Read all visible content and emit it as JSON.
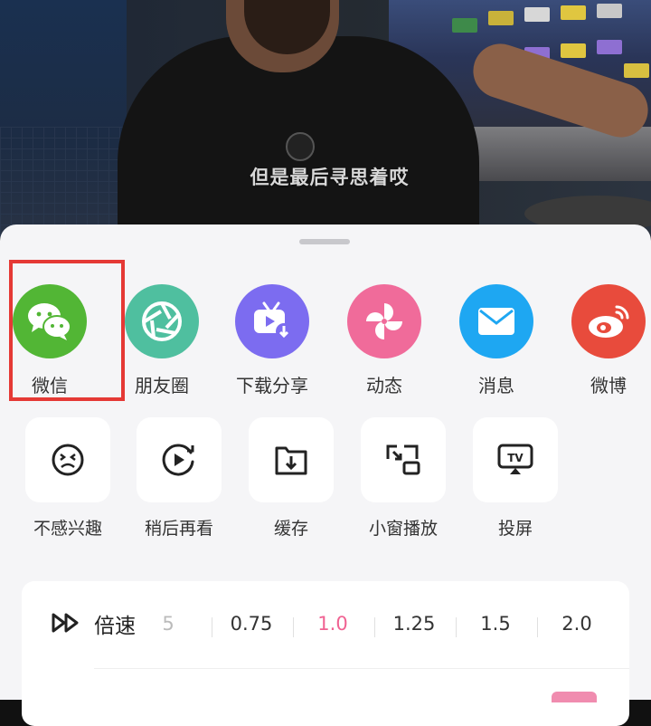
{
  "video": {
    "subtitle": "但是最后寻思着哎"
  },
  "share": {
    "items": [
      {
        "label": "微信",
        "icon": "wechat-icon",
        "color": "#52b635"
      },
      {
        "label": "朋友圈",
        "icon": "moments-icon",
        "color": "#4fbf9f"
      },
      {
        "label": "下载分享",
        "icon": "download-share-icon",
        "color": "#7c6cf0"
      },
      {
        "label": "动态",
        "icon": "pinwheel-icon",
        "color": "#f06b9a"
      },
      {
        "label": "消息",
        "icon": "mail-icon",
        "color": "#1ea7f2"
      },
      {
        "label": "微博",
        "icon": "weibo-icon",
        "color": "#e84b3c"
      }
    ]
  },
  "actions": {
    "items": [
      {
        "label": "不感兴趣",
        "icon": "not-interested-icon"
      },
      {
        "label": "稍后再看",
        "icon": "watch-later-icon"
      },
      {
        "label": "缓存",
        "icon": "cache-download-icon"
      },
      {
        "label": "小窗播放",
        "icon": "picture-in-picture-icon"
      },
      {
        "label": "投屏",
        "icon": "tv-cast-icon"
      }
    ]
  },
  "speed": {
    "label": "倍速",
    "icon": "fast-forward-icon",
    "partial": "5",
    "options": [
      "0.75",
      "1.0",
      "1.25",
      "1.5",
      "2.0"
    ],
    "selected": "1.0",
    "selected_color": "#f06292"
  }
}
